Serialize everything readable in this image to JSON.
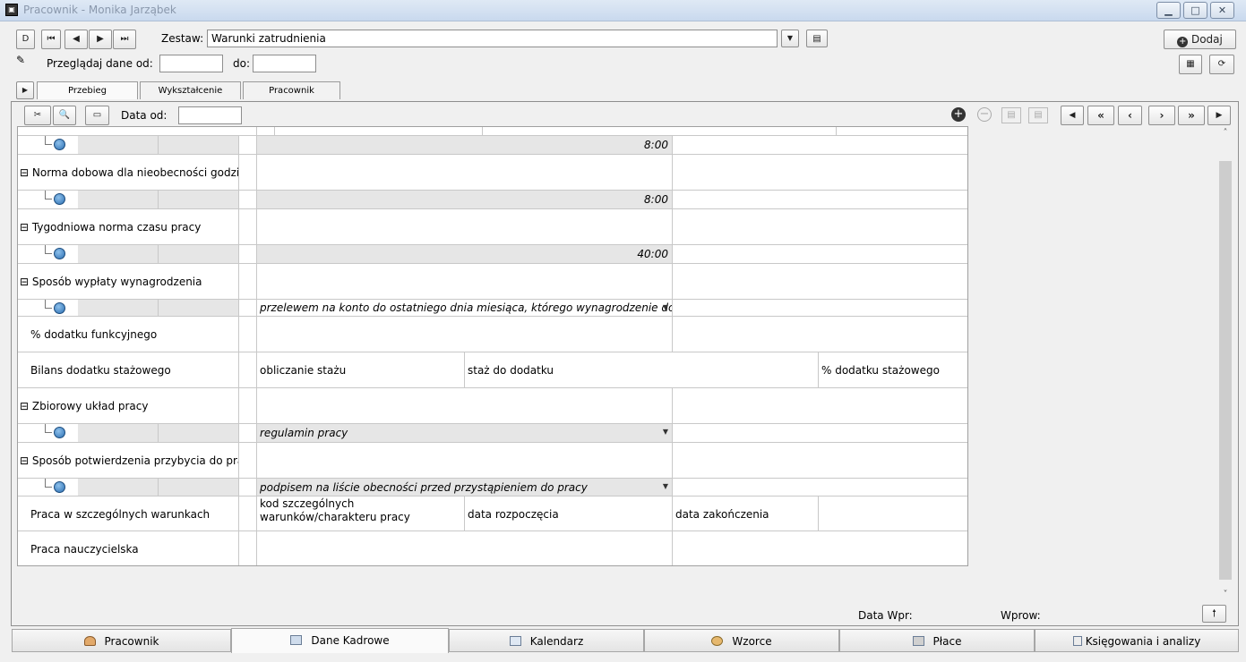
{
  "window": {
    "title": "Pracownik - Monika Jarząbek"
  },
  "toolbar": {
    "nav_first": "D",
    "nav_prev_start": "⏮",
    "nav_prev": "◀",
    "nav_next": "▶",
    "nav_last": "⏭",
    "zestaw_label": "Zestaw:",
    "zestaw_value": "Warunki zatrudnienia",
    "dodaj_label": "Dodaj",
    "browse_from_label": "Przeglądaj dane od:",
    "browse_to_label": "do:",
    "browse_from_value": "",
    "browse_to_value": ""
  },
  "tabs": [
    "Przebieg zatrudnienia...",
    "Wykształcenie",
    "Pracownik"
  ],
  "panel": {
    "data_od_label": "Data od:",
    "data_od_value": ""
  },
  "rows": {
    "r0_value": "8:00",
    "r1_label": "Norma dobowa dla nieobecności godzino...",
    "r2_value": "8:00",
    "r3_label": "Tygodniowa norma czasu pracy",
    "r4_value": "40:00",
    "r5_label": "Sposób wypłaty wynagrodzenia",
    "r6_value": "przelewem na konto do ostatniego dnia miesiąca, którego wynagrodzenie dotyczy",
    "r7_label": "% dodatku funkcyjnego",
    "r8_label": "Bilans dodatku stażowego",
    "r8_col1": "obliczanie stażu",
    "r8_col2": "staż do dodatku",
    "r8_col3": "% dodatku stażowego",
    "r9_label": "Zbiorowy układ pracy",
    "r10_value": "regulamin pracy",
    "r11_label": "Sposób potwierdzenia przybycia do pracy",
    "r12_value": "podpisem na liście obecności przed przystąpieniem do pracy",
    "r13_label": "Praca w szczególnych warunkach",
    "r13_col1": "kod szczególnych warunków/charakteru pracy",
    "r13_col2": "data rozpoczęcia",
    "r13_col3": "data zakończenia",
    "r14_label": "Praca nauczycielska"
  },
  "footer": {
    "data_wpr_label": "Data Wpr:",
    "wprow_label": "Wprow:"
  },
  "bottom_tabs": [
    "Pracownik",
    "Dane Kadrowe",
    "Kalendarz",
    "Wzorce",
    "Płace",
    "Księgowania i analizy"
  ],
  "colors": {
    "window_bg": "#f0f0f0",
    "shade": "#e6e6e6",
    "grid_line": "#c8c8c8"
  }
}
